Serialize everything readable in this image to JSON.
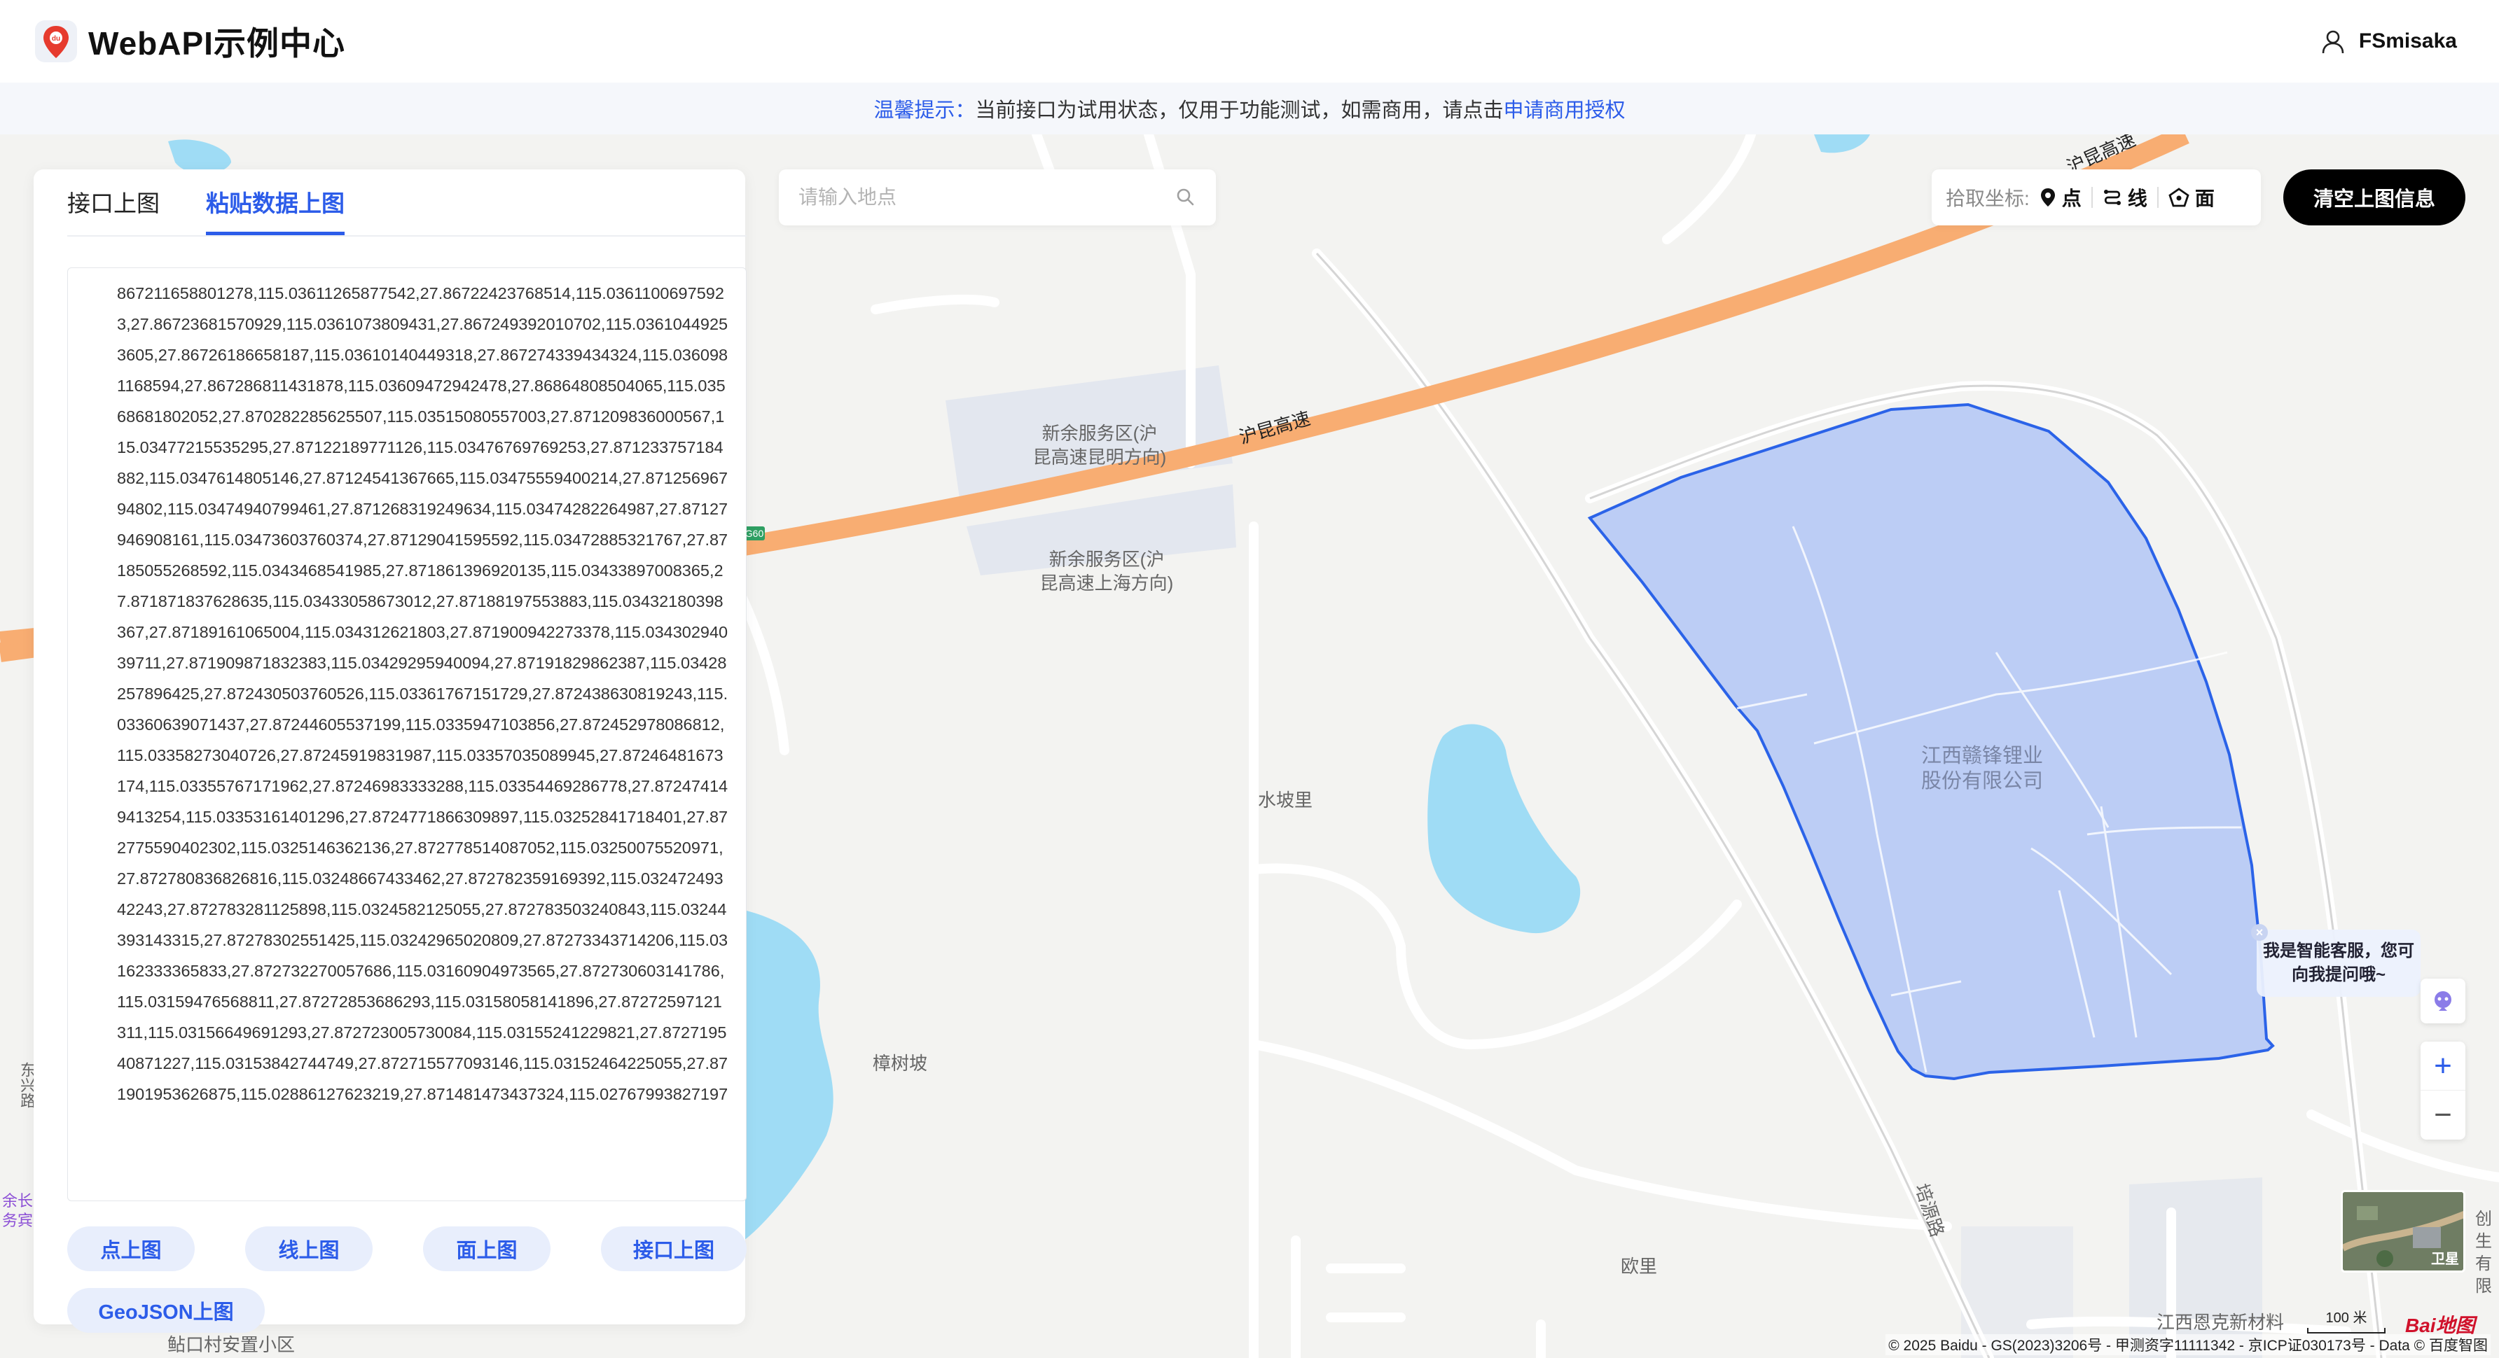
{
  "header": {
    "title": "WebAPI示例中心",
    "logo_icon": "baidu-map-pin-logo",
    "username": "FSmisaka"
  },
  "notice": {
    "tip": "温馨提示：",
    "text": "当前接口为试用状态，仅用于功能测试，如需商用，请点击",
    "link": "申请商用授权"
  },
  "panel": {
    "tabs": [
      {
        "label": "接口上图",
        "active": false
      },
      {
        "label": "粘贴数据上图",
        "active": true
      }
    ],
    "textarea_value": "8672116588012​78,115.03611265877542,27.86722423768514,115.03611006975923,27.86723681570929,115.0361073809431,27.867249392010702,115.03610449253605,27.86726186658187,115.03610140449318,27.867274339434324,115.0360981168594,27.867286811431878,115.03609472942478,27.86864808504065,115.03568681802052,27.870282285625507,115.03515080557003,27.871209836000567,115.03477215535295,27.87122189771126,115.03476769769253,27.871233757184882,115.0347614805146,27.87124541367665,115.03475559400214,27.87125696794802,115.03474940799461,27.871268319249634,115.03474282264987,27.87127946908161,115.03473603760374,27.87129041595592,115.03472885321767,27.87185055268592,115.0343468541985,27.871861396920135,115.03433897008365,27.871871837628635,115.03433058673012,27.87188197553883,115.03432180398367,27.87189161065004,115.034312621803,27.871900942273378,115.03430294039711,27.871909871832383,115.03429295940094,27.87191829862387,115.03428257896425,27.872430503760526,115.03361767151729,27.872438630819243,115.03360639071437,27.87244605537199,115.0335947103856,27.872452978086812,115.03358273040726,27.87245919831987,115.03357035089945,27.87246481673174,115.03355767171962,27.87246983333288,115.03354469286778,27.872474149413254,115.03353161401296,27.87247718663098​97,115.03252841718401,27.872775590402302,115.0325146362136,27.872778514087052,115.03250075520971,27.872780836826816,115.03248667433462,27.872782359169392,115.03247249342243,27.872783281125898,115.0324582125055,27.872783503240843,115.03244393143315,27.87278302551425,115.03242965020809,27.87273343714206,115.03162333365833,27.872732270057686,115.03160904973565,27.872730603141786,115.0315947656881​1,27.87272853686293,115.03158058141896,27.87272597121311,115.03156649691293,27.872723005730084,115.03155241229821,27.872719540871227,115.03153842744749,27.872715577093146,115.03152464225055,27.871901953626875,115.02886127623219,27.871481473437324,115.02767993827197",
    "buttons": [
      "点上图",
      "线上图",
      "面上图",
      "接口上图"
    ],
    "geojson_button": "GeoJSON上图"
  },
  "search": {
    "placeholder": "请输入地点",
    "icon": "search-icon"
  },
  "picker": {
    "label": "拾取坐标:",
    "options": [
      {
        "label": "点",
        "icon": "location-pin-icon"
      },
      {
        "label": "线",
        "icon": "route-line-icon"
      },
      {
        "label": "面",
        "icon": "polygon-icon"
      }
    ]
  },
  "clear_button": "清空上图信息",
  "map": {
    "labels": {
      "service1": "新余服务区(沪\n昆高速昆明方向)",
      "service2": "新余服务区(沪\n昆高速上海方向)",
      "highway": "沪昆高速",
      "highway_top": "沪昆高速",
      "company": "江西赣锋锂业\n股份有限公司",
      "shuipoli": "水坡里",
      "zhangshupo": "樟树坡",
      "ouli": "欧里",
      "peiyuanlu": "培源路",
      "bottom_village": "鲇口村安置小区",
      "enke": "江西恩克新材料",
      "left_road": "东兴路",
      "left_poi": "余长\n务宾",
      "right_poi": "创生\n有限",
      "highway_shield": "G60"
    },
    "colors": {
      "polygon_fill": "#bccdf5",
      "polygon_stroke": "#2b63e8",
      "highway": "#f8ad72",
      "water": "#9fdcf5",
      "background": "#f3f3f1"
    },
    "scale_label": "100 米",
    "satellite_label": "卫星",
    "copyright": "© 2025 Baidu - GS(2023)3206号 - 甲测资字11111342 - 京ICP证030173号 - Data © 百度智图",
    "brand": "Bai地图"
  },
  "ai_assistant": {
    "text": "我是智能客服，您可向我提问哦~",
    "close": "×"
  },
  "zoom": {
    "plus": "+",
    "minus": "−"
  }
}
